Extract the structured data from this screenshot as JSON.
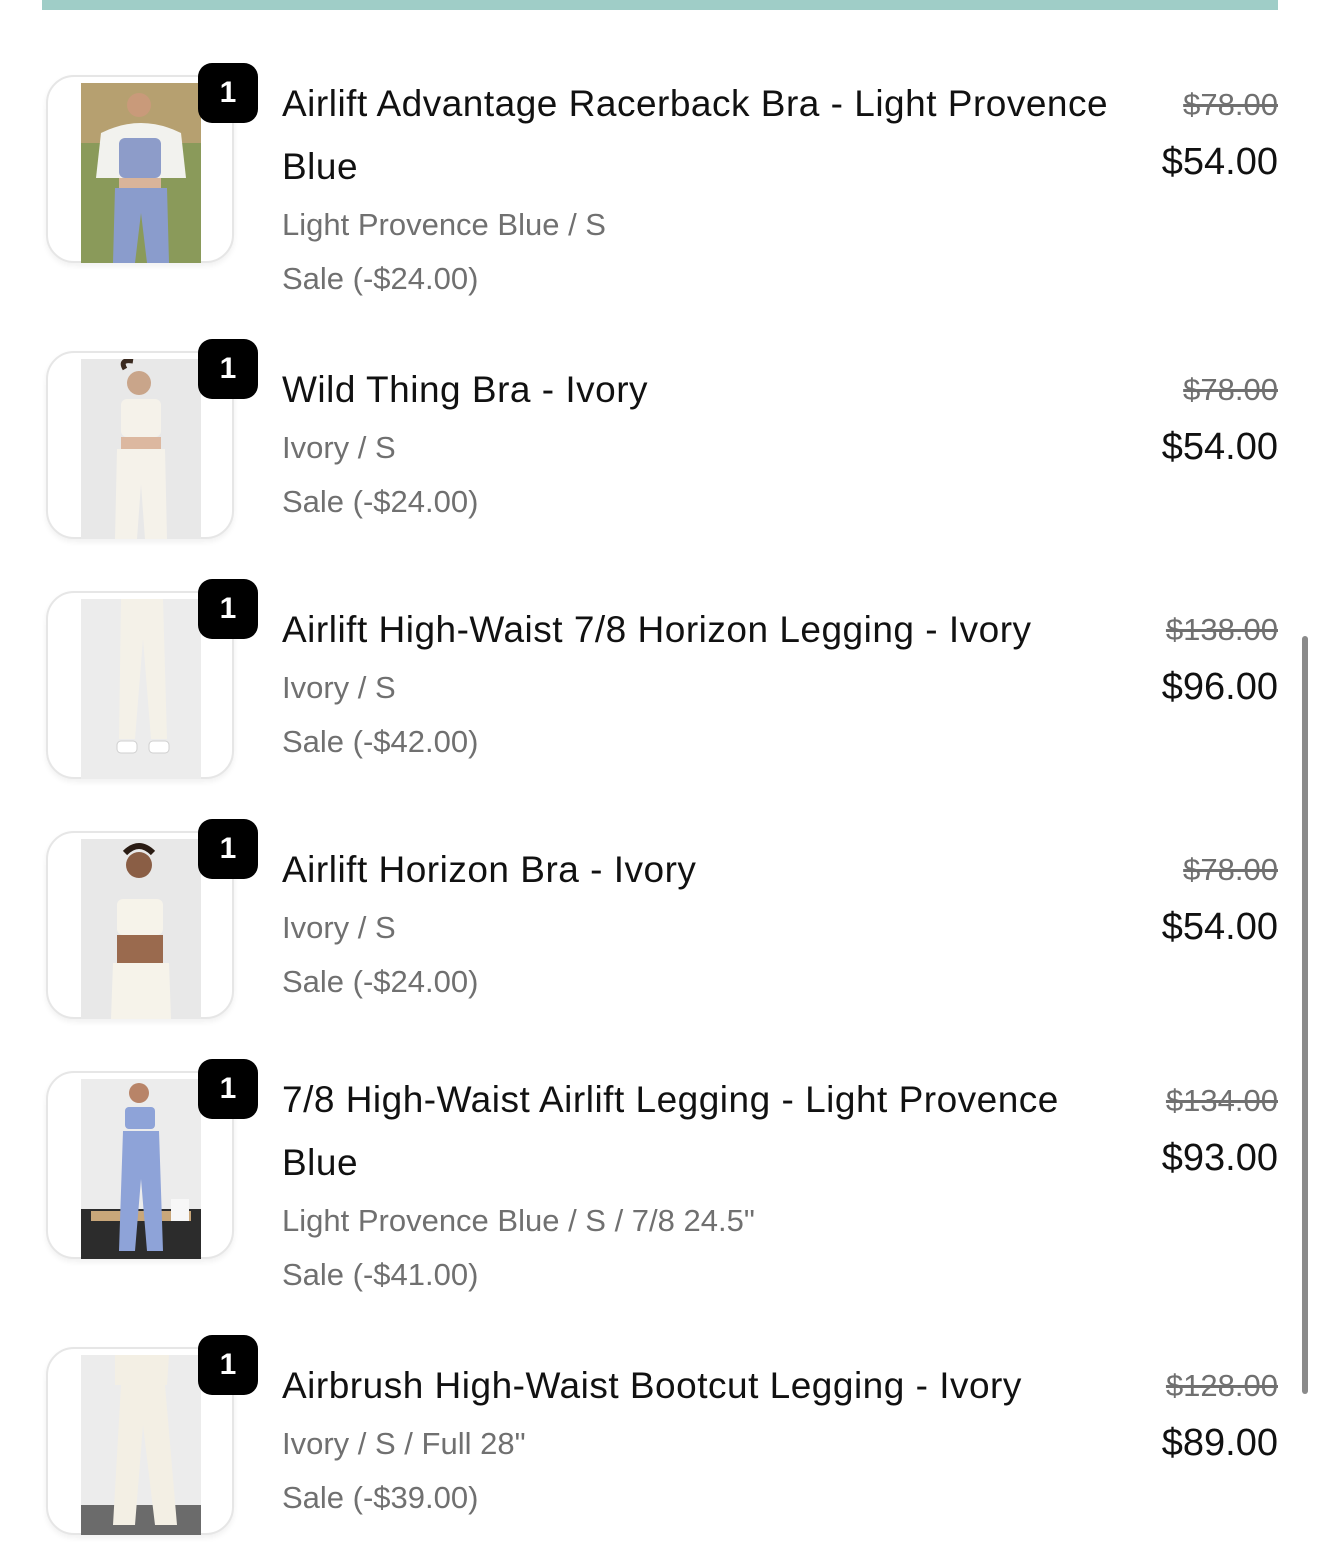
{
  "colors": {
    "accent_bar": "#9fcdc7",
    "badge": "#000000",
    "muted_text": "#707070"
  },
  "items": [
    {
      "title": "Airlift Advantage Racerback Bra - Light Provence Blue",
      "variant": "Light Provence Blue / S",
      "discount": "Sale (-$24.00)",
      "quantity": "1",
      "original_price": "$78.00",
      "sale_price": "$54.00"
    },
    {
      "title": "Wild Thing Bra - Ivory",
      "variant": "Ivory / S",
      "discount": "Sale (-$24.00)",
      "quantity": "1",
      "original_price": "$78.00",
      "sale_price": "$54.00"
    },
    {
      "title": "Airlift High-Waist 7/8 Horizon Legging - Ivory",
      "variant": "Ivory / S",
      "discount": "Sale (-$42.00)",
      "quantity": "1",
      "original_price": "$138.00",
      "sale_price": "$96.00"
    },
    {
      "title": "Airlift Horizon Bra - Ivory",
      "variant": "Ivory / S",
      "discount": "Sale (-$24.00)",
      "quantity": "1",
      "original_price": "$78.00",
      "sale_price": "$54.00"
    },
    {
      "title": "7/8 High-Waist Airlift Legging - Light Provence Blue",
      "variant": "Light Provence Blue / S / 7/8 24.5\"",
      "discount": "Sale (-$41.00)",
      "quantity": "1",
      "original_price": "$134.00",
      "sale_price": "$93.00"
    },
    {
      "title": "Airbrush High-Waist Bootcut Legging - Ivory",
      "variant": "Ivory / S / Full 28\"",
      "discount": "Sale (-$39.00)",
      "quantity": "1",
      "original_price": "$128.00",
      "sale_price": "$89.00"
    }
  ]
}
